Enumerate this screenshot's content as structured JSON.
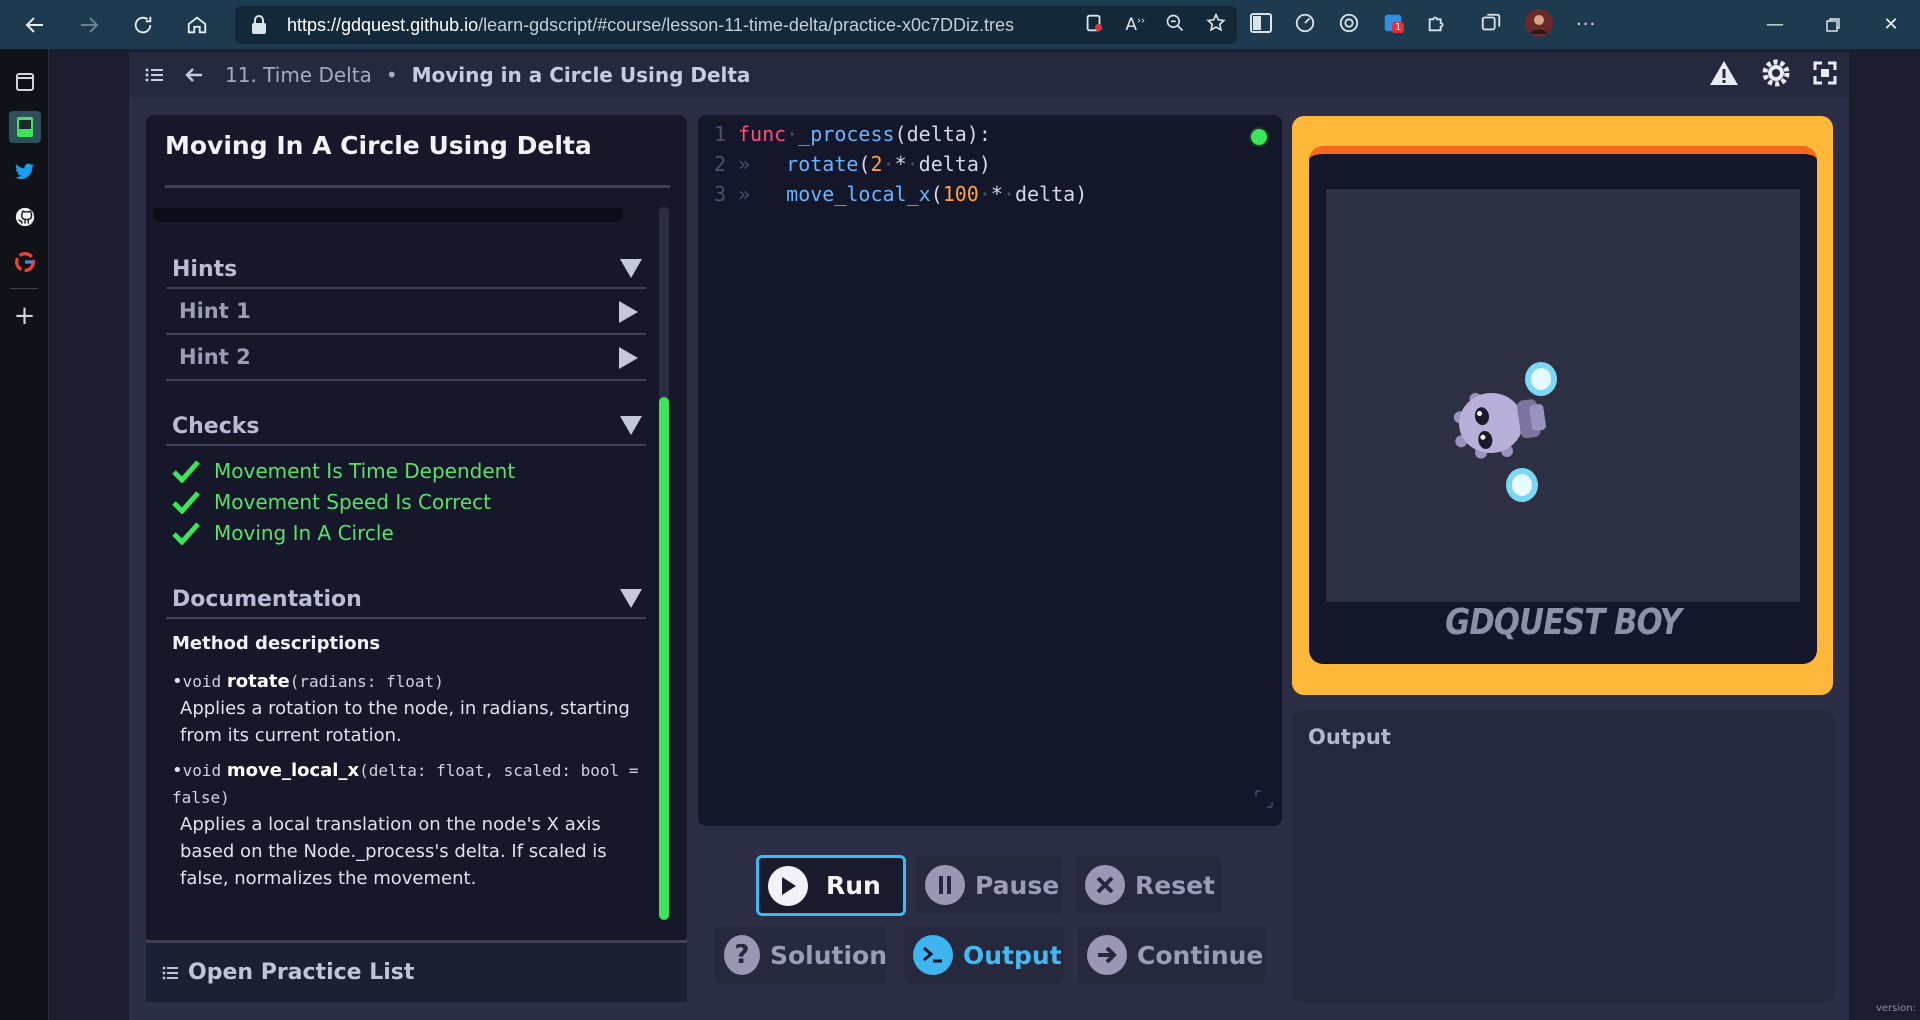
{
  "browser": {
    "url_host": "https://gdquest.github.io",
    "url_path": "/learn-gdscript/#course/lesson-11-time-delta/practice-x0c7DDiz.tres",
    "extension_badge": "1"
  },
  "app": {
    "breadcrumb_lesson": "11. Time Delta",
    "breadcrumb_sep": "•",
    "breadcrumb_practice": "Moving in a Circle Using Delta"
  },
  "left": {
    "title": "Moving In A Circle Using Delta",
    "hints_label": "Hints",
    "hints": [
      "Hint 1",
      "Hint 2"
    ],
    "checks_label": "Checks",
    "checks": [
      "Movement Is Time Dependent",
      "Movement Speed Is Correct",
      "Moving In A Circle"
    ],
    "doc_label": "Documentation",
    "doc_heading": "Method descriptions",
    "methods": [
      {
        "bullet": "•",
        "ret": "void",
        "name": "rotate",
        "sig": "(radians: float)",
        "desc": "Applies a rotation to the node, in radians, starting from its current rotation."
      },
      {
        "bullet": "•",
        "ret": "void",
        "name": "move_local_x",
        "sig": "(delta: float, scaled: bool = false)",
        "desc": "Applies a local translation on the node's X axis based on the Node._process's delta. If scaled is false, normalizes the movement."
      }
    ],
    "footer_label": "Open Practice List"
  },
  "editor": {
    "lines": [
      {
        "n": "1",
        "parts": [
          [
            "kw",
            "func"
          ],
          [
            "ws",
            "·"
          ],
          [
            "fn",
            "_process"
          ],
          [
            "pl",
            "(delta):"
          ]
        ]
      },
      {
        "n": "2",
        "parts": [
          [
            "ws",
            "»   "
          ],
          [
            "fn",
            "rotate"
          ],
          [
            "pl",
            "("
          ],
          [
            "num",
            "2"
          ],
          [
            "ws",
            "·"
          ],
          [
            "pl",
            "*"
          ],
          [
            "ws",
            "·"
          ],
          [
            "pl",
            "delta)"
          ]
        ]
      },
      {
        "n": "3",
        "parts": [
          [
            "ws",
            "»   "
          ],
          [
            "fn",
            "move_local_x"
          ],
          [
            "pl",
            "("
          ],
          [
            "num",
            "100"
          ],
          [
            "ws",
            "·"
          ],
          [
            "pl",
            "*"
          ],
          [
            "ws",
            "·"
          ],
          [
            "pl",
            "delta)"
          ]
        ]
      }
    ]
  },
  "buttons": {
    "run": "Run",
    "pause": "Pause",
    "reset": "Reset",
    "solution": "Solution",
    "output": "Output",
    "continue": "Continue"
  },
  "game": {
    "brand": "GDQUEST BOY"
  },
  "output": {
    "label": "Output"
  },
  "footer": {
    "version": "version:"
  }
}
